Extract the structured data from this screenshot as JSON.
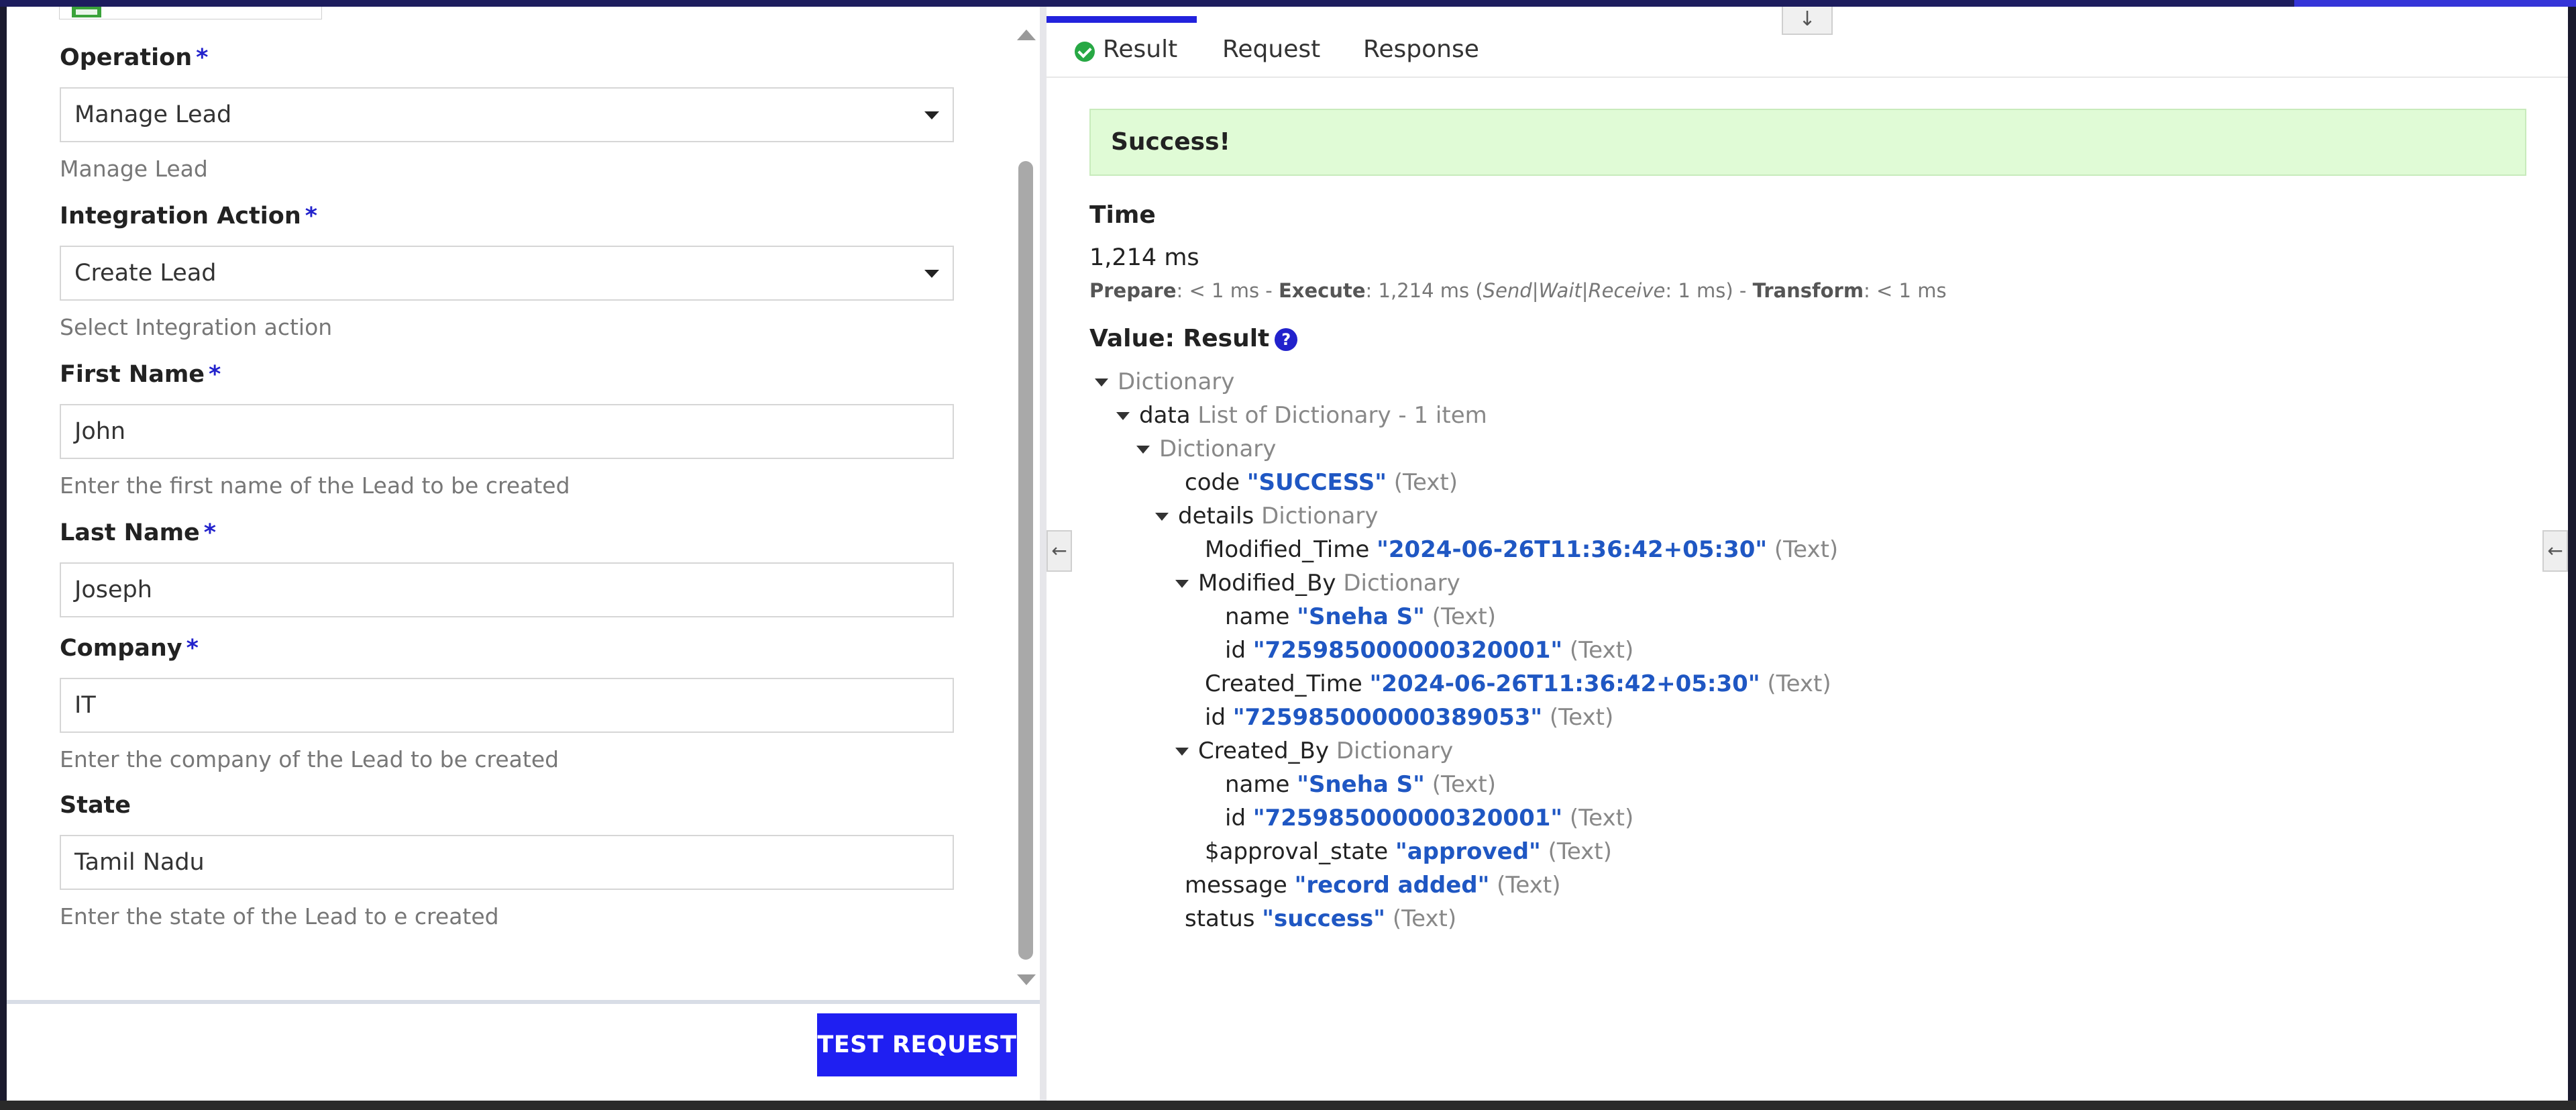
{
  "form": {
    "operation": {
      "label": "Operation",
      "value": "Manage Lead",
      "help": "Manage Lead"
    },
    "integration_action": {
      "label": "Integration Action",
      "value": "Create Lead",
      "help": "Select Integration action"
    },
    "first_name": {
      "label": "First Name",
      "value": "John",
      "help": "Enter the first name of the Lead to be created"
    },
    "last_name": {
      "label": "Last Name",
      "value": "Joseph"
    },
    "company": {
      "label": "Company",
      "value": "IT",
      "help": "Enter the company of the Lead to be created"
    },
    "state": {
      "label": "State",
      "value": "Tamil Nadu",
      "help": "Enter the state of the Lead to e created"
    },
    "required_mark": "*"
  },
  "footer": {
    "test_button": "TEST REQUEST"
  },
  "tabs": {
    "result": "Result",
    "request": "Request",
    "response": "Response"
  },
  "result": {
    "banner": "Success!",
    "time_title": "Time",
    "time_value": "1,214 ms",
    "breakdown": {
      "prepare_label": "Prepare",
      "prepare_value": ": < 1 ms - ",
      "execute_label": "Execute",
      "execute_value": ": 1,214 ms (",
      "swr_label": "Send|Wait|Receive",
      "swr_value": ": 1 ms) - ",
      "transform_label": "Transform",
      "transform_value": ": < 1 ms"
    },
    "value_title": "Value: Result",
    "help_glyph": "?"
  },
  "tree": {
    "root": "Dictionary",
    "data_key": "data",
    "data_type": "List of Dictionary - 1 item",
    "item": "Dictionary",
    "code_key": "code",
    "code_val": "\"SUCCESS\"",
    "text_type": "(Text)",
    "details_key": "details",
    "details_type": "Dictionary",
    "modified_time_key": "Modified_Time",
    "modified_time_val": "\"2024-06-26T11:36:42+05:30\"",
    "modified_by_key": "Modified_By",
    "modified_by_type": "Dictionary",
    "mb_name_key": "name",
    "mb_name_val": "\"Sneha S\"",
    "mb_id_key": "id",
    "mb_id_val": "\"725985000000320001\"",
    "created_time_key": "Created_Time",
    "created_time_val": "\"2024-06-26T11:36:42+05:30\"",
    "id_key": "id",
    "id_val": "\"725985000000389053\"",
    "created_by_key": "Created_By",
    "created_by_type": "Dictionary",
    "cb_name_key": "name",
    "cb_name_val": "\"Sneha S\"",
    "cb_id_key": "id",
    "cb_id_val": "\"725985000000320001\"",
    "approval_key": "$approval_state",
    "approval_val": "\"approved\"",
    "message_key": "message",
    "message_val": "\"record added\"",
    "status_key": "status",
    "status_val": "\"success\""
  },
  "colors": {
    "accent": "#1f1ff2",
    "success_bg": "#e0fbd6",
    "value_blue": "#1f57c3",
    "required": "#2222cc"
  },
  "icons": {
    "collapse": "down-arrow-icon",
    "left_arrow": "left-arrow-icon",
    "check": "check-circle-icon",
    "help": "help-circle-icon"
  }
}
